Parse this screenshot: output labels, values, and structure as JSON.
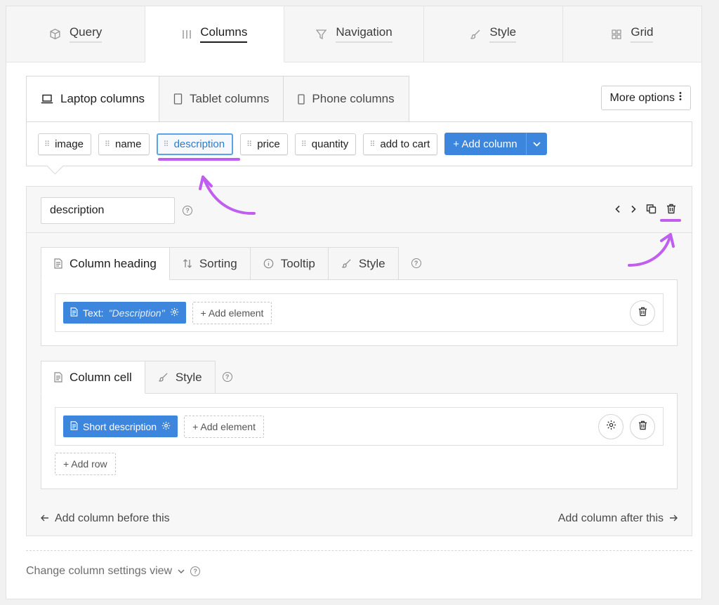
{
  "top_tabs": [
    {
      "label": "Query",
      "icon": "cube-icon"
    },
    {
      "label": "Columns",
      "icon": "columns-icon",
      "active": true
    },
    {
      "label": "Navigation",
      "icon": "filter-icon"
    },
    {
      "label": "Style",
      "icon": "brush-icon"
    },
    {
      "label": "Grid",
      "icon": "grid-icon"
    }
  ],
  "device_tabs": [
    {
      "label": "Laptop columns",
      "icon": "laptop-icon",
      "active": true
    },
    {
      "label": "Tablet columns",
      "icon": "tablet-icon"
    },
    {
      "label": "Phone columns",
      "icon": "phone-icon"
    }
  ],
  "more_options": "More options",
  "columns": [
    "image",
    "name",
    "description",
    "price",
    "quantity",
    "add to cart"
  ],
  "selected_column": "description",
  "add_column": "+ Add column",
  "column_editor": {
    "name_value": "description",
    "heading_tabs": [
      "Column heading",
      "Sorting",
      "Tooltip",
      "Style"
    ],
    "heading_element": {
      "prefix": "Text:",
      "value": "\"Description\""
    },
    "add_element": "+ Add element",
    "cell_tabs": [
      "Column cell",
      "Style"
    ],
    "cell_element": "Short description",
    "add_row": "+ Add row",
    "add_before": "Add column before this",
    "add_after": "Add column after this"
  },
  "settings_view": "Change column settings view",
  "colors": {
    "accent": "#3c86de",
    "annotation": "#c05ef0"
  }
}
